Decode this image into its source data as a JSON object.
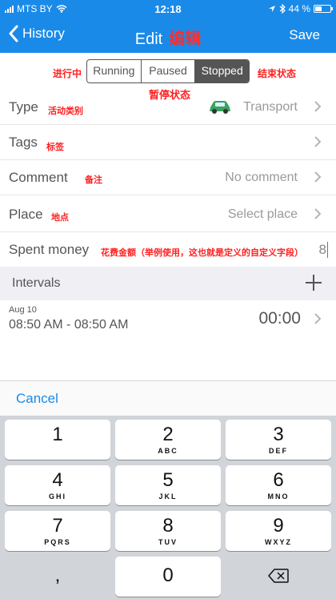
{
  "status_bar": {
    "carrier": "MTS BY",
    "time": "12:18",
    "battery": "44 %",
    "battery_level": 0.44
  },
  "nav": {
    "back_label": "History",
    "title": "Edit",
    "title_annotation": "编辑",
    "save_label": "Save"
  },
  "annotations": {
    "running": "进行中",
    "stopped": "结束状态",
    "paused": "暂停状态",
    "type": "活动类别",
    "tags": "标签",
    "comment": "备注",
    "place": "地点",
    "spent_money": "花费金额（举例使用，这也就是定义的自定义字段）"
  },
  "state_segment": {
    "options": [
      "Running",
      "Paused",
      "Stopped"
    ],
    "selected": "Stopped"
  },
  "rows": {
    "type": {
      "label": "Type",
      "value": "Transport",
      "icon": "car-icon"
    },
    "tags": {
      "label": "Tags",
      "value": ""
    },
    "comment": {
      "label": "Comment",
      "value": "No comment"
    },
    "place": {
      "label": "Place",
      "value": "Select place"
    },
    "spent_money": {
      "label": "Spent money",
      "value": "8"
    }
  },
  "intervals": {
    "header": "Intervals",
    "items": [
      {
        "date": "Aug 10",
        "range": "08:50 AM  - 08:50 AM",
        "duration": "00:00"
      }
    ]
  },
  "cancel_label": "Cancel",
  "keypad": {
    "keys": [
      {
        "digit": "1",
        "letters": ""
      },
      {
        "digit": "2",
        "letters": "ABC"
      },
      {
        "digit": "3",
        "letters": "DEF"
      },
      {
        "digit": "4",
        "letters": "GHI"
      },
      {
        "digit": "5",
        "letters": "JKL"
      },
      {
        "digit": "6",
        "letters": "MNO"
      },
      {
        "digit": "7",
        "letters": "PQRS"
      },
      {
        "digit": "8",
        "letters": "TUV"
      },
      {
        "digit": "9",
        "letters": "WXYZ"
      },
      {
        "digit": ",",
        "letters": ""
      },
      {
        "digit": "0",
        "letters": ""
      }
    ]
  },
  "colors": {
    "accent": "#1a8ae8",
    "annotation": "#ff2020",
    "segment": "#555555"
  }
}
